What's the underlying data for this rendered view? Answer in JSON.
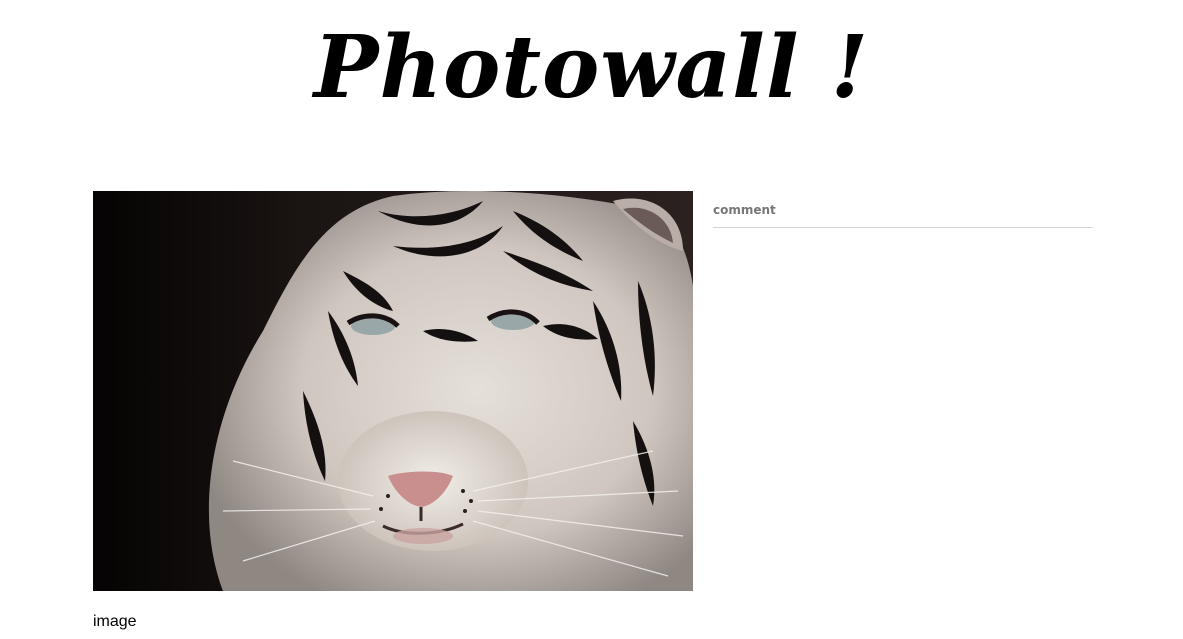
{
  "site": {
    "title": "Photowall !"
  },
  "photo": {
    "caption": "image",
    "subject": "white tiger"
  },
  "comments": {
    "heading": "comment"
  },
  "colors": {
    "background": "#ffffff",
    "title": "#000000",
    "comment_heading": "#777777",
    "divider": "#d4d4d4"
  }
}
